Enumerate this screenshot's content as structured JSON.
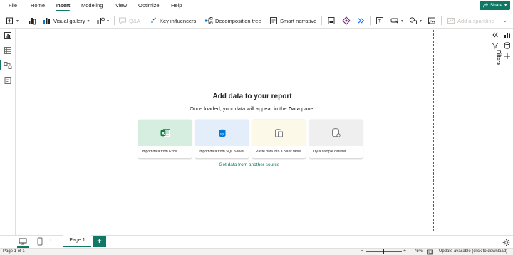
{
  "menu": {
    "items": [
      "File",
      "Home",
      "Insert",
      "Modeling",
      "View",
      "Optimize",
      "Help"
    ],
    "active": "Insert",
    "share_label": "Share"
  },
  "ribbon": {
    "visual_gallery": "Visual gallery",
    "qna": "Q&A",
    "key_influencers": "Key influencers",
    "decomposition_tree": "Decomposition tree",
    "smart_narrative": "Smart narrative",
    "add_sparkline": "Add a sparkline"
  },
  "canvas": {
    "title": "Add data to your report",
    "subtitle_before": "Once loaded, your data will appear in the ",
    "subtitle_bold": "Data",
    "subtitle_after": " pane.",
    "cards": [
      {
        "label": "Import data from Excel",
        "icon": "excel-icon",
        "bg": "#d6eedf"
      },
      {
        "label": "Import data from SQL Server",
        "icon": "sql-server-icon",
        "bg": "#e3eefa"
      },
      {
        "label": "Paste data into a blank table",
        "icon": "paste-icon",
        "bg": "#fdf9e8"
      },
      {
        "label": "Try a sample dataset",
        "icon": "sample-dataset-icon",
        "bg": "#efefef"
      }
    ],
    "get_data_link": "Get data from another source →"
  },
  "right_pane": {
    "filters_label": "Filters"
  },
  "tabs": {
    "page_label": "Page 1",
    "add_label": "+"
  },
  "status": {
    "page_info": "Page 1 of 1",
    "zoom": "75%",
    "update": "Update available (click to download)"
  },
  "colors": {
    "accent": "#117865",
    "excel": "#107c41",
    "sql": "#0078d4"
  }
}
